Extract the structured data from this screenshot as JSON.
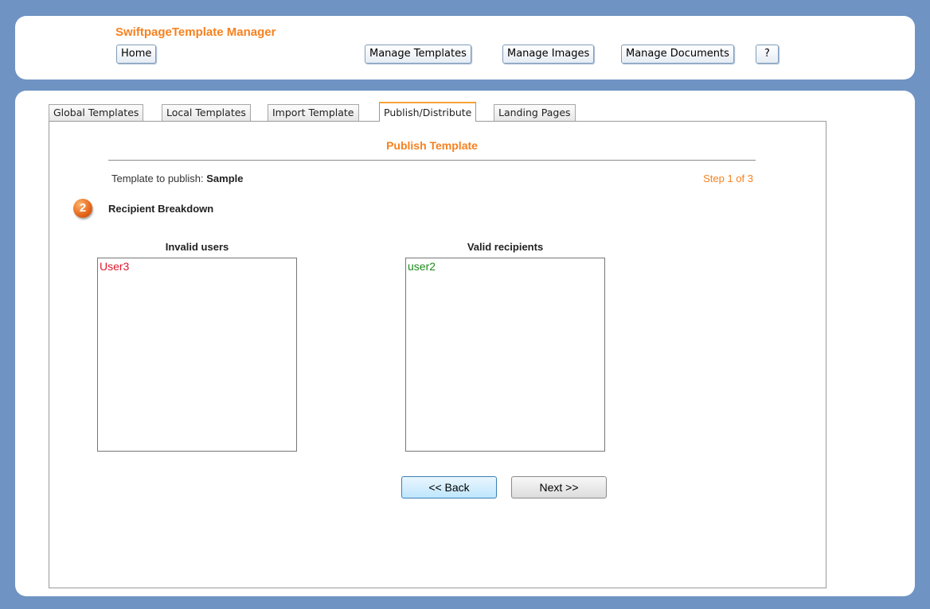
{
  "app": {
    "title": "SwiftpageTemplate Manager"
  },
  "header_nav": {
    "home": "Home",
    "manage_templates": "Manage Templates",
    "manage_images": "Manage Images",
    "manage_documents": "Manage Documents",
    "help": "?"
  },
  "tabs": [
    {
      "label": "Global Templates",
      "active": false
    },
    {
      "label": "Local Templates",
      "active": false
    },
    {
      "label": "Import Template",
      "active": false
    },
    {
      "label": "Publish/Distribute",
      "active": true
    },
    {
      "label": "Landing Pages",
      "active": false
    }
  ],
  "publish": {
    "title": "Publish Template",
    "template_prefix": "Template to publish:",
    "template_name": "Sample",
    "step_text": "Step 1 of 3",
    "step_badge_number": "2",
    "section_label": "Recipient Breakdown"
  },
  "invalid_users": {
    "label": "Invalid users",
    "items": [
      "User3"
    ]
  },
  "valid_recipients": {
    "label": "Valid recipients",
    "items": [
      "user2"
    ]
  },
  "buttons": {
    "back": "<< Back",
    "next": "Next >>"
  },
  "colors": {
    "accent": "#f7811f",
    "invalid": "#e0182d",
    "valid": "#1c8a1c",
    "background": "#6f93c3"
  }
}
